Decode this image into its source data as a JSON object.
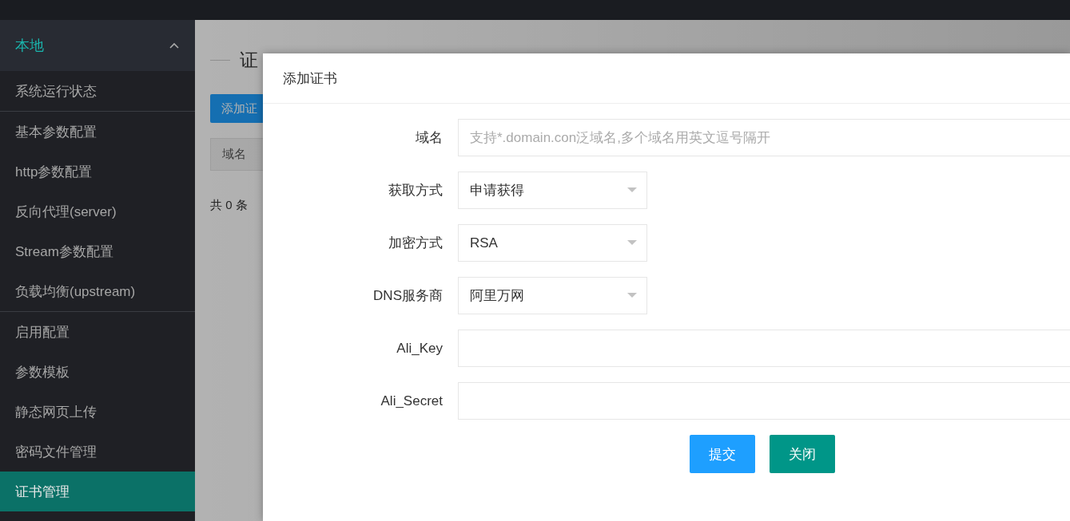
{
  "sidebar": {
    "group": {
      "label": "本地",
      "expanded": true
    },
    "sections": [
      [
        {
          "label": "系统运行状态",
          "selected": false
        }
      ],
      [
        {
          "label": "基本参数配置",
          "selected": false
        },
        {
          "label": "http参数配置",
          "selected": false
        },
        {
          "label": "反向代理(server)",
          "selected": false
        },
        {
          "label": "Stream参数配置",
          "selected": false
        },
        {
          "label": "负载均衡(upstream)",
          "selected": false
        }
      ],
      [
        {
          "label": "启用配置",
          "selected": false
        },
        {
          "label": "参数模板",
          "selected": false
        },
        {
          "label": "静态网页上传",
          "selected": false
        },
        {
          "label": "密码文件管理",
          "selected": false
        },
        {
          "label": "证书管理",
          "selected": true
        }
      ]
    ]
  },
  "page": {
    "title": "证",
    "add_button": "添加证",
    "table": {
      "columns": [
        "域名"
      ]
    },
    "total": "共 0 条"
  },
  "dialog": {
    "title": "添加证书",
    "fields": [
      {
        "label": "域名",
        "kind": "text",
        "placeholder": "支持*.domain.con泛域名,多个域名用英文逗号隔开"
      },
      {
        "label": "获取方式",
        "kind": "select",
        "value": "申请获得"
      },
      {
        "label": "加密方式",
        "kind": "select",
        "value": "RSA"
      },
      {
        "label": "DNS服务商",
        "kind": "select",
        "value": "阿里万网"
      },
      {
        "label": "Ali_Key",
        "kind": "text"
      },
      {
        "label": "Ali_Secret",
        "kind": "text"
      }
    ],
    "buttons": [
      {
        "label": "提交",
        "kind": "primary"
      },
      {
        "label": "关闭",
        "kind": "secondary"
      }
    ]
  }
}
